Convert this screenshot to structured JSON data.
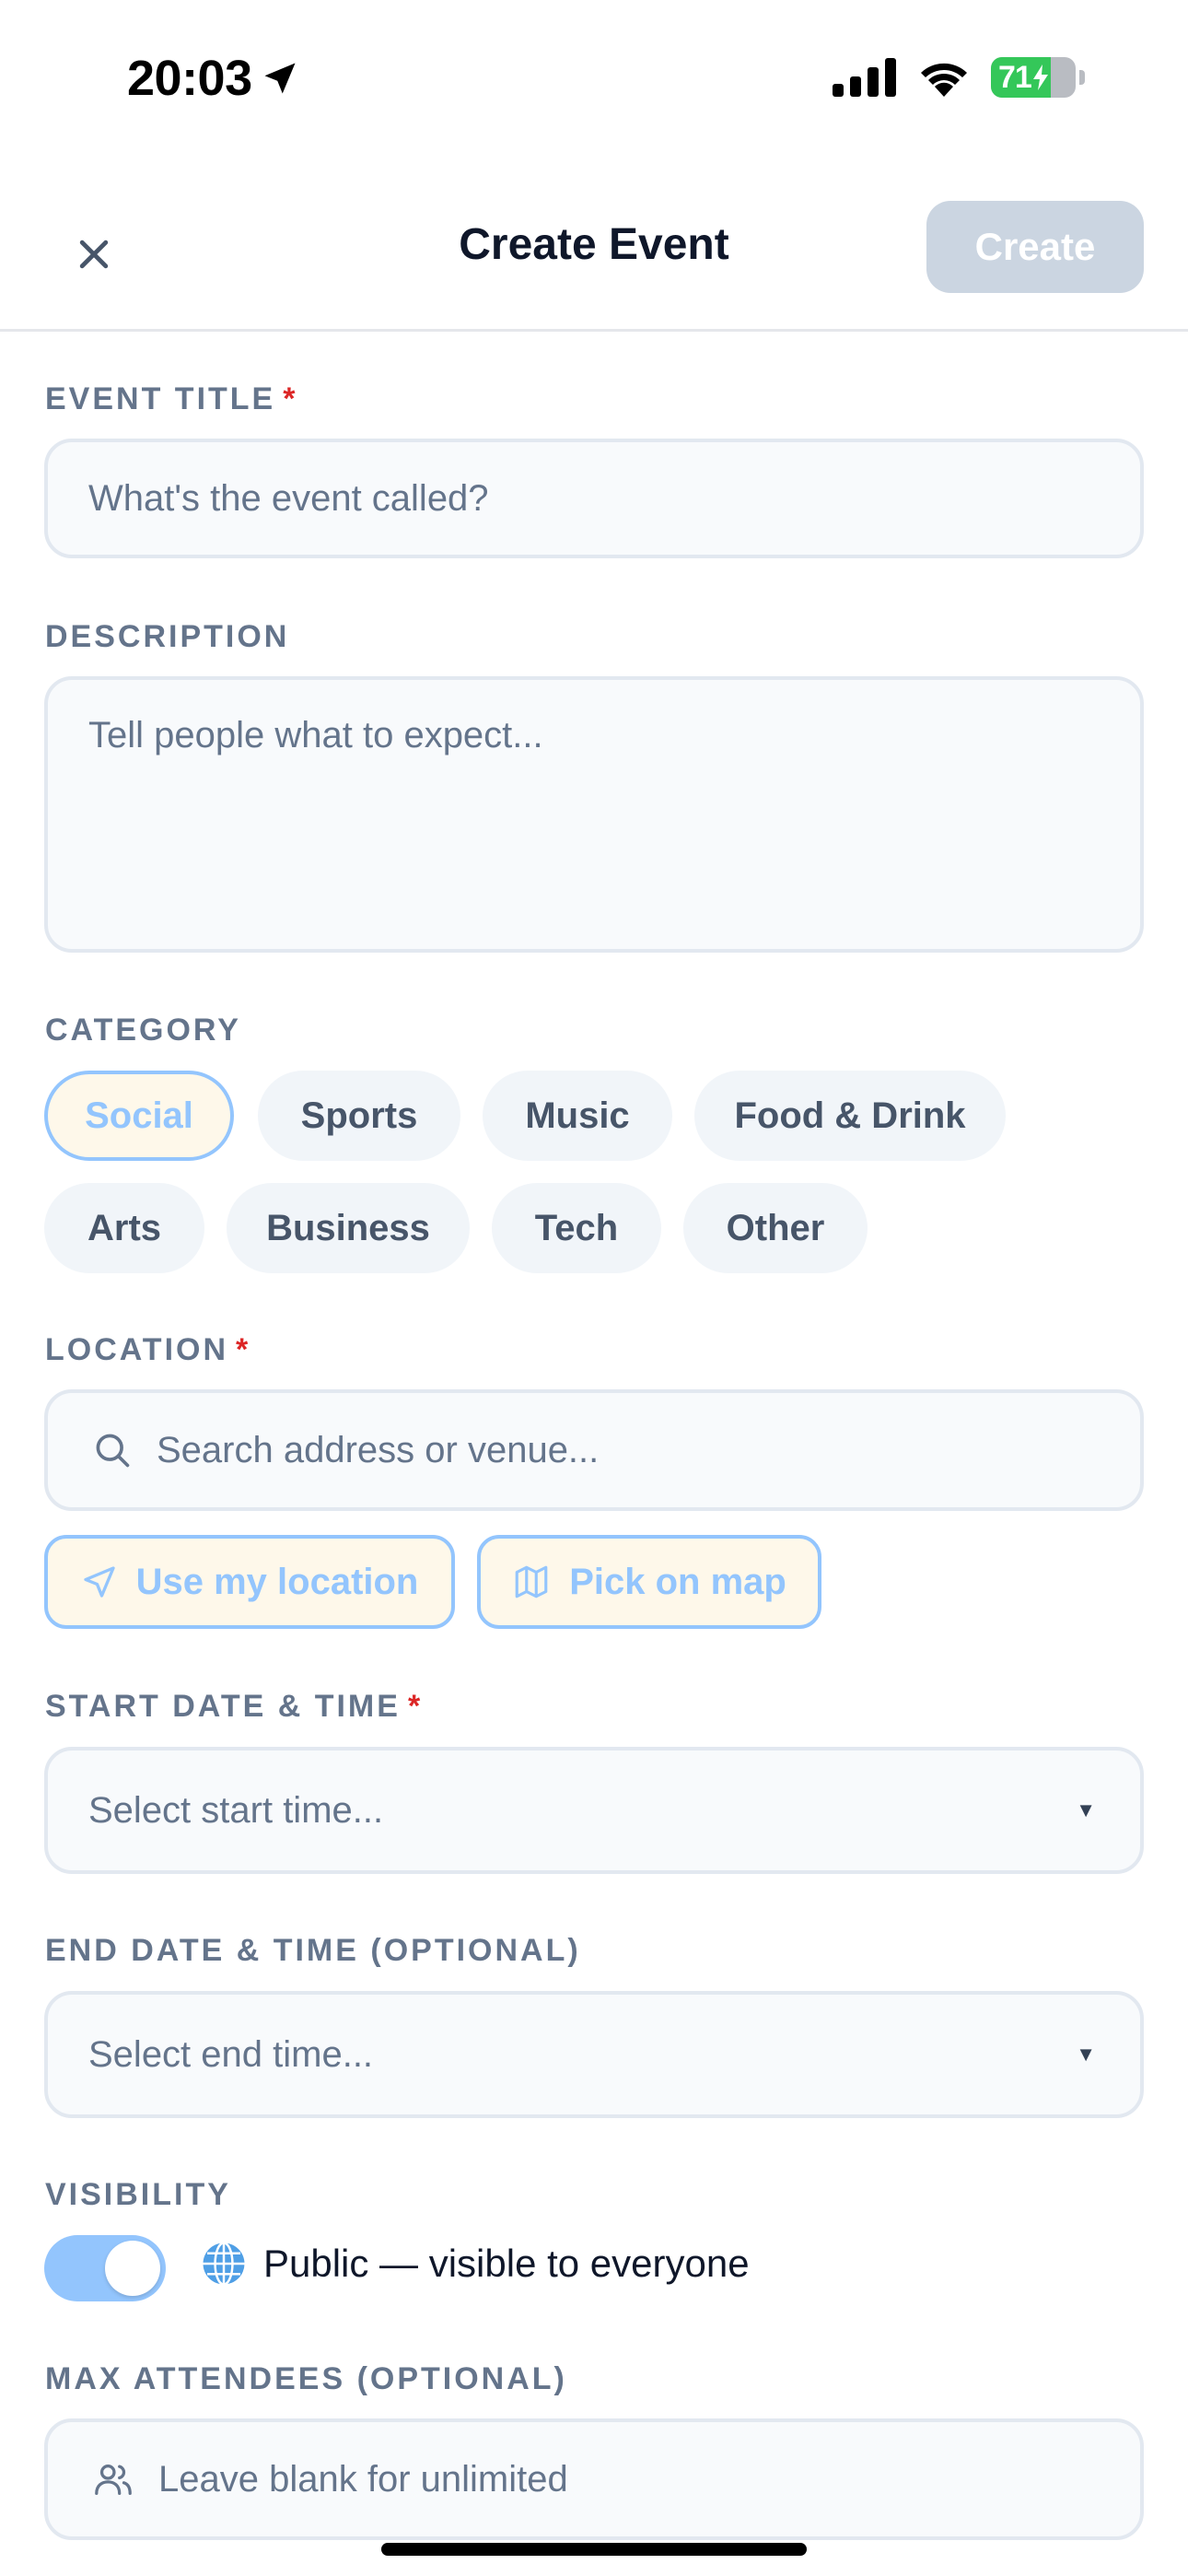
{
  "status_bar": {
    "time": "20:03",
    "battery_percent": "71",
    "battery_level": 0.71
  },
  "header": {
    "title": "Create Event",
    "create_label": "Create"
  },
  "form": {
    "title": {
      "label": "EVENT TITLE",
      "required_mark": "*",
      "placeholder": "What's the event called?"
    },
    "description": {
      "label": "DESCRIPTION",
      "placeholder": "Tell people what to expect..."
    },
    "category": {
      "label": "CATEGORY",
      "options": [
        "Social",
        "Sports",
        "Music",
        "Food & Drink",
        "Arts",
        "Business",
        "Tech",
        "Other"
      ],
      "selected": "Social"
    },
    "location": {
      "label": "LOCATION",
      "required_mark": "*",
      "placeholder": "Search address or venue...",
      "use_my_location": "Use my location",
      "pick_on_map": "Pick on map"
    },
    "start": {
      "label": "START DATE & TIME",
      "required_mark": "*",
      "placeholder": "Select start time..."
    },
    "end": {
      "label": "END DATE & TIME (OPTIONAL)",
      "placeholder": "Select end time..."
    },
    "visibility": {
      "label": "VISIBILITY",
      "on": true,
      "text": "Public — visible to everyone"
    },
    "max_attendees": {
      "label": "MAX ATTENDEES (OPTIONAL)",
      "placeholder": "Leave blank for unlimited"
    }
  },
  "colors": {
    "accent": "#93c5fd",
    "accent_bg": "#fef8ea",
    "required": "#dc2626",
    "disabled_button": "#cbd5e1",
    "battery_green": "#34c759"
  },
  "icons": {
    "close": "close-icon",
    "search": "search-icon",
    "navigation": "navigation-arrow-icon",
    "map": "map-icon",
    "globe": "globe-icon",
    "users": "users-icon"
  }
}
